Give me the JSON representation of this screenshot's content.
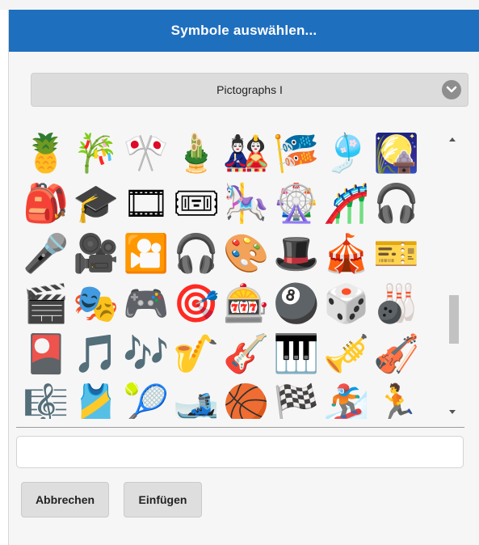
{
  "dialog": {
    "title": "Symbole auswählen...",
    "category": "Pictographs I",
    "symbols": [
      "🍍",
      "🎋",
      "🎌",
      "🎍",
      "🎎",
      "🎏",
      "🎐",
      "🎑",
      "🎒",
      "🎓",
      "🎞",
      "🎟",
      "🎠",
      "🎡",
      "🎢",
      "🎧",
      "🎤",
      "🎥",
      "🎦",
      "🎧",
      "🎨",
      "🎩",
      "🎪",
      "🎫",
      "🎬",
      "🎭",
      "🎮",
      "🎯",
      "🎰",
      "🎱",
      "🎲",
      "🎳",
      "🎴",
      "🎵",
      "🎶",
      "🎷",
      "🎸",
      "🎹",
      "🎺",
      "🎻",
      "🎼",
      "🎽",
      "🎾",
      "🎿",
      "🏀",
      "🏁",
      "🏂",
      "🏃"
    ],
    "input_value": "",
    "cancel_label": "Abbrechen",
    "insert_label": "Einfügen"
  }
}
